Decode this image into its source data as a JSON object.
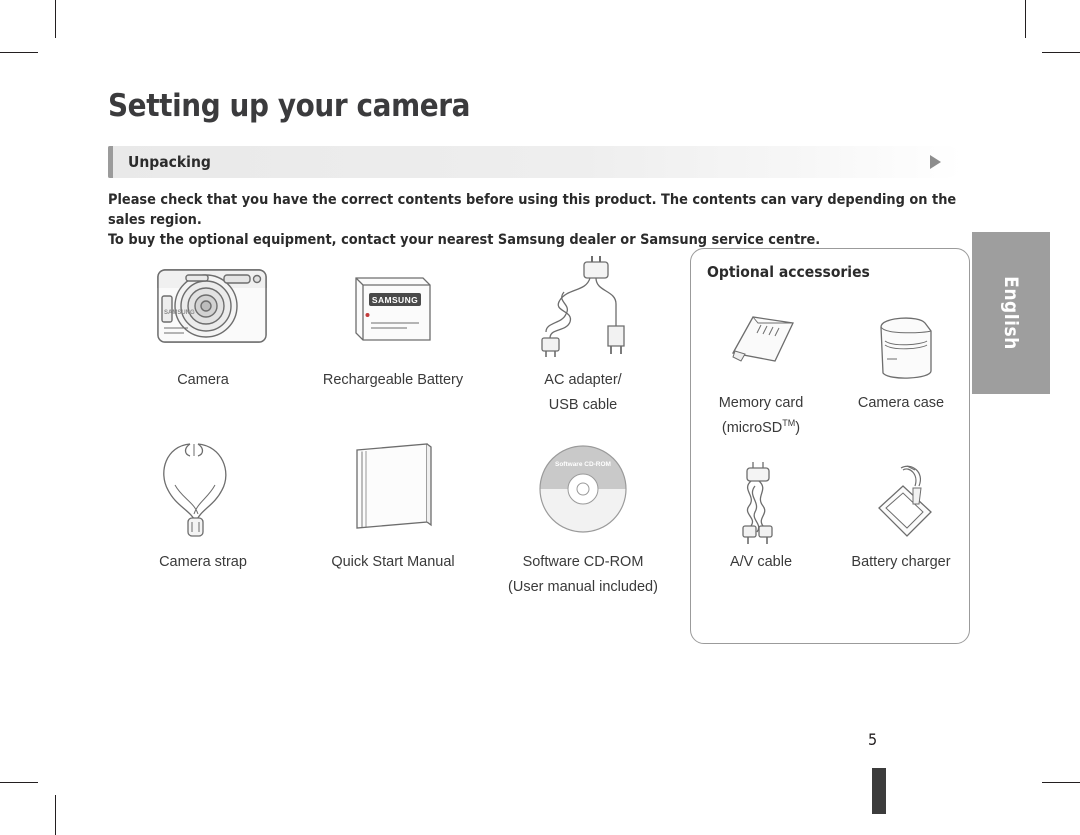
{
  "document": {
    "title": "Setting up your camera",
    "section": {
      "label": "Unpacking",
      "arrow_icon": "triangle-right-icon"
    },
    "intro_line1": "Please check that you have the correct contents before using this product. The contents can vary depending on the sales region.",
    "intro_line2": "To buy the optional equipment, contact your nearest Samsung dealer or Samsung service centre.",
    "contents": [
      {
        "caption": "Camera",
        "caption2": "",
        "icon": "camera-icon"
      },
      {
        "caption": "Rechargeable Battery",
        "caption2": "",
        "icon": "battery-icon",
        "brand": "SAMSUNG"
      },
      {
        "caption": "AC adapter/",
        "caption2": "USB cable",
        "icon": "ac-adapter-usb-cable-icon"
      },
      {
        "caption": "Camera strap",
        "caption2": "",
        "icon": "camera-strap-icon"
      },
      {
        "caption": "Quick Start Manual",
        "caption2": "",
        "icon": "manual-icon"
      },
      {
        "caption": "Software CD-ROM",
        "caption2": "(User manual included)",
        "icon": "cd-rom-icon",
        "disc_label": "Software CD-ROM"
      }
    ],
    "optional": {
      "title": "Optional accessories",
      "items": [
        {
          "caption": "Memory card",
          "caption2": "(microSD",
          "caption2_sup": "TM",
          "caption2_end": ")",
          "icon": "memory-card-icon"
        },
        {
          "caption": "Camera case",
          "caption2": "",
          "icon": "camera-case-icon"
        },
        {
          "caption": "A/V cable",
          "caption2": "",
          "icon": "av-cable-icon"
        },
        {
          "caption": "Battery charger",
          "caption2": "",
          "icon": "battery-charger-icon"
        }
      ]
    },
    "language_tab": "English",
    "page_number": "5",
    "colors": {
      "text": "#231f20",
      "section_bar_accent": "#9b9b9b",
      "tab_background": "#9e9e9e",
      "line_art": "#6d6d6d"
    }
  }
}
